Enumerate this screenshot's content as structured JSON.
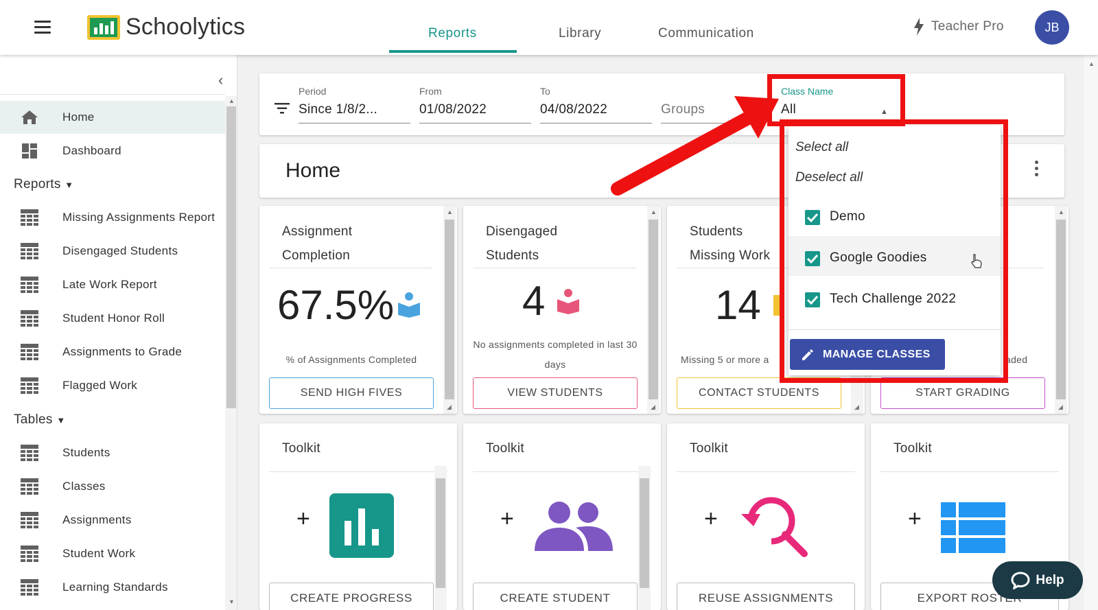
{
  "header": {
    "brand": "Schoolytics",
    "tabs": [
      {
        "label": "Reports"
      },
      {
        "label": "Library"
      },
      {
        "label": "Communication"
      }
    ],
    "plan_label": "Teacher Pro",
    "avatar_initials": "JB",
    "accent_color": "#17968a"
  },
  "sidebar": {
    "items_top": [
      {
        "label": "Home",
        "icon": "home-icon"
      },
      {
        "label": "Dashboard",
        "icon": "dashboard-icon"
      }
    ],
    "reports_section": "Reports",
    "reports": [
      {
        "label": "Missing Assignments Report"
      },
      {
        "label": "Disengaged Students"
      },
      {
        "label": "Late Work Report"
      },
      {
        "label": "Student Honor Roll"
      },
      {
        "label": "Assignments to Grade"
      },
      {
        "label": "Flagged Work"
      }
    ],
    "tables_section": "Tables",
    "tables": [
      {
        "label": "Students"
      },
      {
        "label": "Classes"
      },
      {
        "label": "Assignments"
      },
      {
        "label": "Student Work"
      },
      {
        "label": "Learning Standards"
      }
    ]
  },
  "filters": {
    "period_label": "Period",
    "period_value": "Since 1/8/2...",
    "from_label": "From",
    "from_value": "01/08/2022",
    "to_label": "To",
    "to_value": "04/08/2022",
    "groups_placeholder": "Groups",
    "class_label": "Class Name",
    "class_value": "All"
  },
  "home": {
    "title": "Home"
  },
  "cards": [
    {
      "title_line1": "Assignment",
      "title_line2": "Completion",
      "value": "67.5%",
      "caption": "% of Assignments Completed",
      "button": "SEND HIGH FIVES",
      "button_color": "#4aa3df"
    },
    {
      "title_line1": "Disengaged",
      "title_line2": "Students",
      "value": "4",
      "caption": "No assignments completed in last 30 days",
      "button": "VIEW STUDENTS",
      "button_color": "#e8557a"
    },
    {
      "title_line1": "Students",
      "title_line2": "Missing Work",
      "value": "14",
      "caption": "Missing 5 or more a",
      "button": "CONTACT STUDENTS",
      "button_color": "#f2c230"
    },
    {
      "title_line1": "",
      "title_line2": "",
      "value": "",
      "caption": "aded",
      "button": "START GRADING",
      "button_color": "#c64fd0"
    }
  ],
  "toolkits": [
    {
      "title": "Toolkit",
      "plus": "+",
      "icon": "bar-chart-icon",
      "button": "CREATE PROGRESS"
    },
    {
      "title": "Toolkit",
      "plus": "+",
      "icon": "people-icon",
      "button": "CREATE STUDENT"
    },
    {
      "title": "Toolkit",
      "plus": "+",
      "icon": "search-refresh-icon",
      "button": "REUSE ASSIGNMENTS"
    },
    {
      "title": "Toolkit",
      "plus": "+",
      "icon": "table-icon",
      "button": "EXPORT ROSTER"
    }
  ],
  "class_dropdown": {
    "select_all": "Select all",
    "deselect_all": "Deselect all",
    "options": [
      {
        "label": "Demo",
        "checked": true
      },
      {
        "label": "Google Goodies",
        "checked": true
      },
      {
        "label": "Tech Challenge 2022",
        "checked": true
      }
    ],
    "manage_button": "MANAGE CLASSES"
  },
  "help_button": "Help",
  "highlight_color": "#ee1111"
}
